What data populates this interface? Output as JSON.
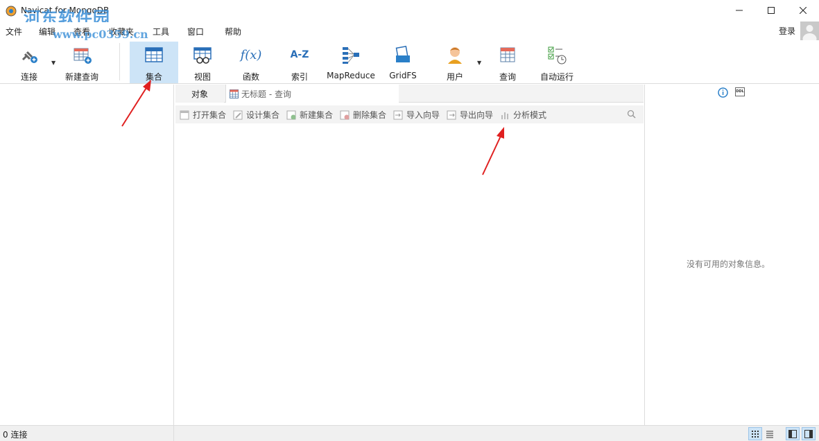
{
  "window": {
    "title": "Navicat for MongoDB",
    "watermark": "河东软件园",
    "watermark_url": "www.pc0359.cn"
  },
  "menu": {
    "items": [
      "文件",
      "编辑",
      "查看",
      "收藏夹",
      "工具",
      "窗口",
      "帮助"
    ],
    "login": "登录"
  },
  "toolbar": {
    "connect": "连接",
    "new_query": "新建查询",
    "collection": "集合",
    "view": "视图",
    "function": "函数",
    "index": "索引",
    "mapreduce": "MapReduce",
    "gridfs": "GridFS",
    "user": "用户",
    "query": "查询",
    "automation": "自动运行",
    "index_icon_text": "A-Z",
    "function_icon_text": "f(x)"
  },
  "tabs": {
    "objects": "对象",
    "query_tab": "无标题 - 查询"
  },
  "object_toolbar": {
    "open": "打开集合",
    "design": "设计集合",
    "new": "新建集合",
    "delete": "删除集合",
    "import": "导入向导",
    "export": "导出向导",
    "analyze": "分析模式"
  },
  "right_panel": {
    "no_info": "没有可用的对象信息。",
    "ddl_icon_text": "DDL"
  },
  "status": {
    "connections": "0 连接"
  },
  "colors": {
    "accent": "#3a8fd8",
    "active_bg": "#cde4f7",
    "arrow": "#e02020"
  }
}
